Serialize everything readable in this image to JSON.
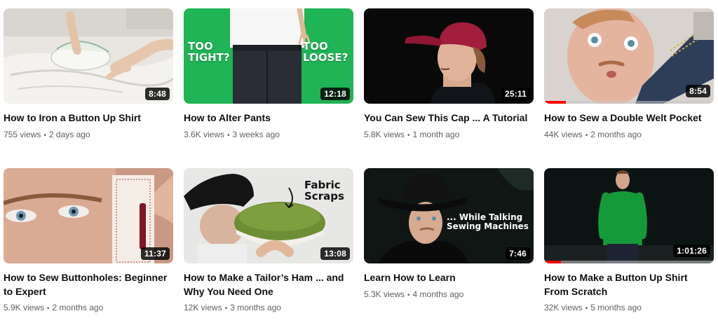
{
  "videos": [
    {
      "title": "How to Iron a Button Up Shirt",
      "duration": "8:48",
      "views": "755 views",
      "age": "2 days ago",
      "watched_fraction": 0,
      "thumb_icon": "ironing-hand-image"
    },
    {
      "title": "How to Alter Pants",
      "duration": "12:18",
      "views": "3.6K views",
      "age": "3 weeks ago",
      "watched_fraction": 0,
      "thumb_text_left": "TOO\nTIGHT?",
      "thumb_text_right": "TOO\nLOOSE?",
      "thumb_icon": "pants-green-background-image"
    },
    {
      "title": "You Can Sew This Cap ... A Tutorial",
      "duration": "25:11",
      "views": "5.8K views",
      "age": "1 month ago",
      "watched_fraction": 0,
      "thumb_icon": "man-red-cap-image"
    },
    {
      "title": "How to Sew a Double Welt Pocket",
      "duration": "8:54",
      "views": "44K views",
      "age": "2 months ago",
      "watched_fraction": 0.13,
      "thumb_icon": "man-with-pocket-image"
    },
    {
      "title": "How to Sew Buttonholes: Beginner to Expert",
      "duration": "11:37",
      "views": "5.9K views",
      "age": "2 months ago",
      "watched_fraction": 0,
      "thumb_icon": "eye-buttonhole-image"
    },
    {
      "title": "How to Make a Tailor’s Ham ... and Why You Need One",
      "duration": "13:08",
      "views": "12K views",
      "age": "3 months ago",
      "watched_fraction": 0,
      "thumb_text_right": "Fabric\nScraps",
      "thumb_icon": "tailors-ham-image"
    },
    {
      "title": "Learn How to Learn",
      "duration": "7:46",
      "views": "5.3K views",
      "age": "4 months ago",
      "watched_fraction": 0,
      "thumb_text_right": "... While Talking\nSewing Machines",
      "thumb_icon": "man-cowboy-hat-image"
    },
    {
      "title": "How to Make a Button Up Shirt From Scratch",
      "duration": "1:01:26",
      "views": "32K views",
      "age": "5 months ago",
      "watched_fraction": 0.1,
      "thumb_icon": "man-green-shirt-image"
    }
  ],
  "colors": {
    "progress": "#ff0000",
    "green_bg": "#1fb455",
    "meta_text": "#606060"
  }
}
